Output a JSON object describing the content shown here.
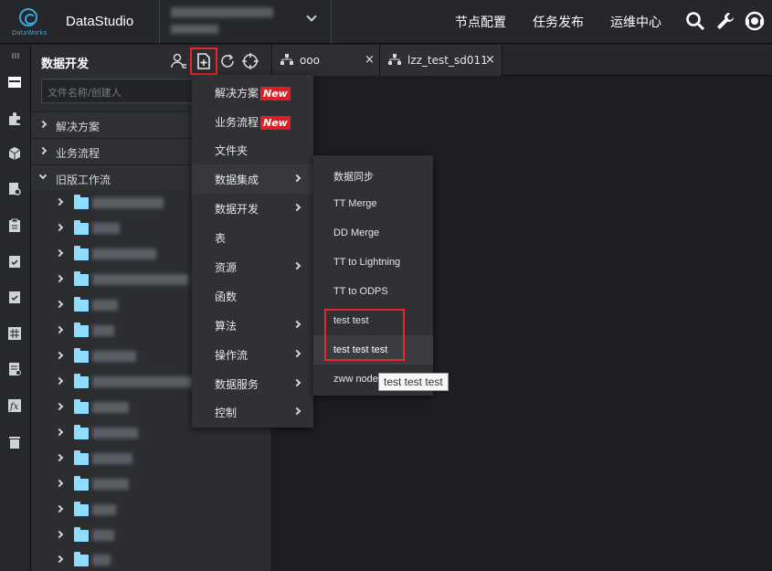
{
  "header": {
    "logo_caption": "DataWorks",
    "app_name": "DataStudio",
    "nav": [
      "节点配置",
      "任务发布",
      "运维中心"
    ]
  },
  "sidebar": {
    "title": "数据开发",
    "search_placeholder": "文件名称/创建人",
    "sections": [
      {
        "label": "解决方案",
        "expanded": false
      },
      {
        "label": "业务流程",
        "expanded": false
      },
      {
        "label": "旧版工作流",
        "expanded": true
      }
    ],
    "tree_folders_count_label": ""
  },
  "tabs": [
    {
      "label": "ooo",
      "close": "×"
    },
    {
      "label": "lzz_test_sd011",
      "close": "×"
    }
  ],
  "create_menu": {
    "items": [
      {
        "label": "解决方案",
        "badge": "New",
        "submenu": false
      },
      {
        "label": "业务流程",
        "badge": "New",
        "submenu": false
      },
      {
        "label": "文件夹",
        "badge": "",
        "submenu": false
      },
      {
        "label": "数据集成",
        "badge": "",
        "submenu": true
      },
      {
        "label": "数据开发",
        "badge": "",
        "submenu": true
      },
      {
        "label": "表",
        "badge": "",
        "submenu": false
      },
      {
        "label": "资源",
        "badge": "",
        "submenu": true
      },
      {
        "label": "函数",
        "badge": "",
        "submenu": false
      },
      {
        "label": "算法",
        "badge": "",
        "submenu": true
      },
      {
        "label": "操作流",
        "badge": "",
        "submenu": true
      },
      {
        "label": "数据服务",
        "badge": "",
        "submenu": true
      },
      {
        "label": "控制",
        "badge": "",
        "submenu": true
      }
    ]
  },
  "integration_submenu": {
    "items": [
      "数据同步",
      "TT Merge",
      "DD Merge",
      "TT to Lightning",
      "TT to ODPS",
      "test test",
      "test test test",
      "zww node"
    ],
    "hovered": "test test test"
  },
  "tooltip": "test test test",
  "colors": {
    "accent_red": "#e5282c",
    "new_badge": "#e21d23",
    "folder": "#8fdcff",
    "logo": "#3aa6d8"
  }
}
